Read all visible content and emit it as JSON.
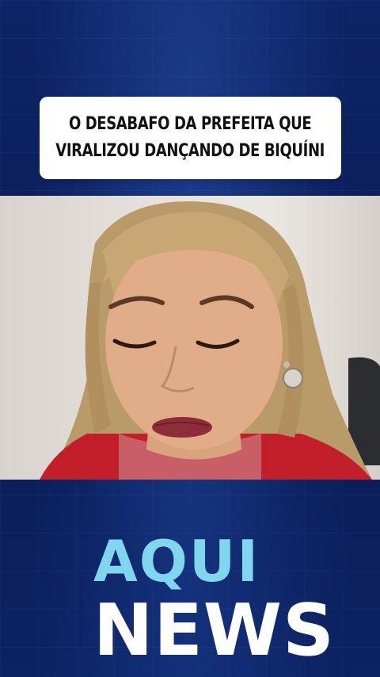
{
  "headline": {
    "line1": "O DESABAFO DA PREFEITA QUE",
    "line2": "VIRALIZOU DANÇANDO DE BIQUÍNI"
  },
  "video": {
    "description_icon": "video-frame-woman"
  },
  "logo": {
    "word1": "AQUI",
    "word2": "NEWS",
    "word1_color": "#7fd6ee",
    "word2_color": "#ffffff"
  },
  "colors": {
    "background": "#0b1f5e",
    "headline_box": "#ffffff",
    "headline_text": "#111111"
  }
}
